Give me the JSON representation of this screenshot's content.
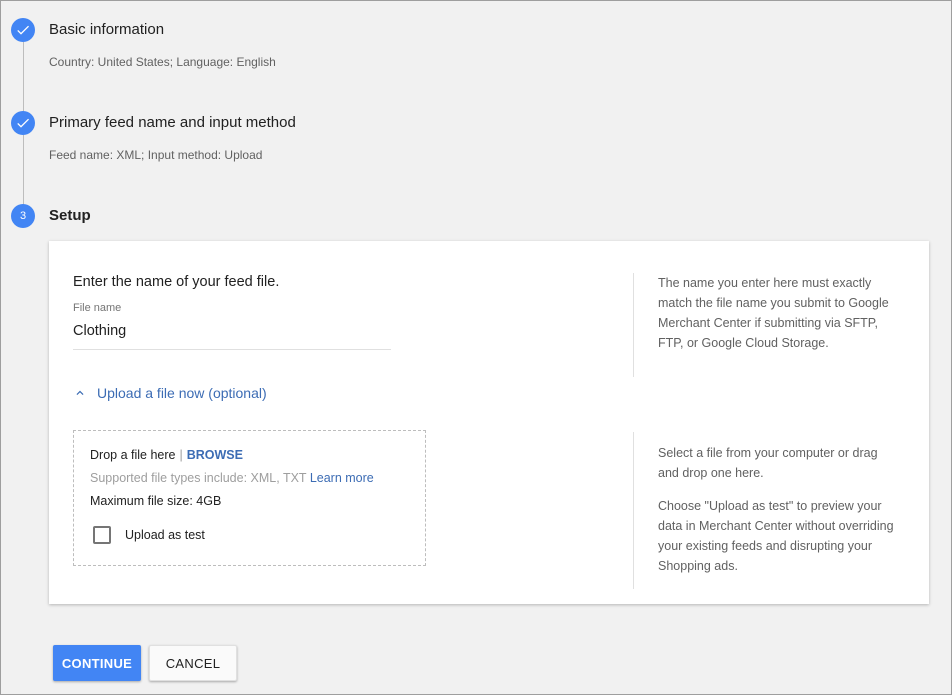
{
  "steps": [
    {
      "title": "Basic information",
      "subtitle": "Country: United States; Language: English",
      "status": "complete"
    },
    {
      "title": "Primary feed name and input method",
      "subtitle": "Feed name: XML; Input method: Upload",
      "status": "complete"
    },
    {
      "number": "3",
      "title": "Setup",
      "status": "active"
    }
  ],
  "setup": {
    "prompt": "Enter the name of your feed file.",
    "file_name_label": "File name",
    "file_name_value": "Clothing",
    "help_file_name": "The name you enter here must exactly match the file name you submit to Google Merchant Center if submitting via SFTP, FTP, or Google Cloud Storage.",
    "upload_toggle_label": "Upload a file now (optional)",
    "dropzone": {
      "drop_text": "Drop a file here",
      "separator": "|",
      "browse_label": "BROWSE",
      "supported_text": "Supported file types include: XML, TXT",
      "learn_more_label": "Learn more",
      "max_size_text": "Maximum file size: 4GB",
      "upload_as_test_label": "Upload as test"
    },
    "help_upload_1": "Select a file from your computer or drag and drop one here.",
    "help_upload_2": "Choose \"Upload as test\" to preview your data in Merchant Center without overriding your existing feeds and disrupting your Shopping ads."
  },
  "buttons": {
    "continue_label": "CONTINUE",
    "cancel_label": "CANCEL"
  },
  "colors": {
    "accent": "#4285f4",
    "link": "#3c6cb4"
  },
  "icons": {
    "step_complete": "check-icon",
    "upload_toggle": "chevron-up-icon"
  }
}
